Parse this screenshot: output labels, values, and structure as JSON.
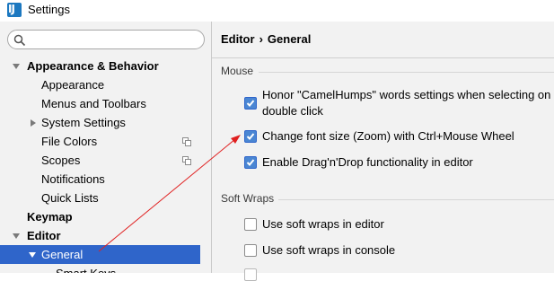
{
  "window": {
    "title": "Settings",
    "app_icon_text": "IJ"
  },
  "sidebar": {
    "search_placeholder": "",
    "items": [
      {
        "label": "Appearance & Behavior",
        "bold": true
      },
      {
        "label": "Appearance"
      },
      {
        "label": "Menus and Toolbars"
      },
      {
        "label": "System Settings"
      },
      {
        "label": "File Colors"
      },
      {
        "label": "Scopes"
      },
      {
        "label": "Notifications"
      },
      {
        "label": "Quick Lists"
      },
      {
        "label": "Keymap",
        "bold": true
      },
      {
        "label": "Editor",
        "bold": true
      },
      {
        "label": "General",
        "selected": true
      },
      {
        "label": "Smart Keys"
      }
    ]
  },
  "main": {
    "breadcrumb": {
      "parent": "Editor",
      "separator": "›",
      "current": "General"
    },
    "sections": {
      "mouse": {
        "title": "Mouse",
        "options": [
          {
            "label_line1": "Honor \"CamelHumps\" words settings when selecting on",
            "label_line2": "double click",
            "checked": true
          },
          {
            "label": "Change font size (Zoom) with Ctrl+Mouse Wheel",
            "checked": true
          },
          {
            "label": "Enable Drag'n'Drop functionality in editor",
            "checked": true
          }
        ]
      },
      "soft_wraps": {
        "title": "Soft Wraps",
        "options": [
          {
            "label": "Use soft wraps in editor",
            "checked": false
          },
          {
            "label": "Use soft wraps in console",
            "checked": false
          }
        ]
      }
    }
  },
  "colors": {
    "selection": "#2f65ca",
    "checkbox_checked": "#4a86d3",
    "annotation_arrow": "#e02020"
  }
}
